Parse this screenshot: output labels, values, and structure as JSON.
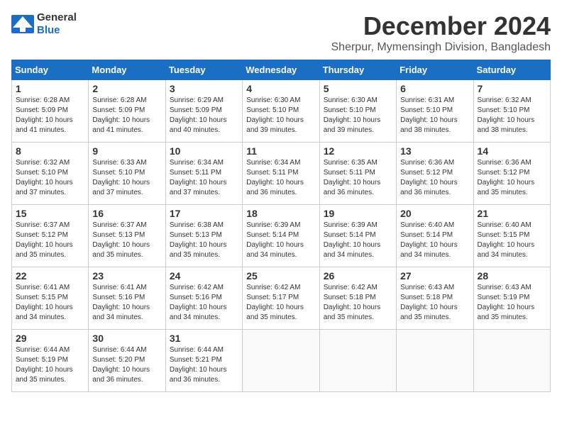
{
  "logo": {
    "general": "General",
    "blue": "Blue"
  },
  "header": {
    "month": "December 2024",
    "location": "Sherpur, Mymensingh Division, Bangladesh"
  },
  "weekdays": [
    "Sunday",
    "Monday",
    "Tuesday",
    "Wednesday",
    "Thursday",
    "Friday",
    "Saturday"
  ],
  "weeks": [
    [
      {
        "day": "1",
        "sunrise": "6:28 AM",
        "sunset": "5:09 PM",
        "daylight": "10 hours and 41 minutes."
      },
      {
        "day": "2",
        "sunrise": "6:28 AM",
        "sunset": "5:09 PM",
        "daylight": "10 hours and 41 minutes."
      },
      {
        "day": "3",
        "sunrise": "6:29 AM",
        "sunset": "5:09 PM",
        "daylight": "10 hours and 40 minutes."
      },
      {
        "day": "4",
        "sunrise": "6:30 AM",
        "sunset": "5:10 PM",
        "daylight": "10 hours and 39 minutes."
      },
      {
        "day": "5",
        "sunrise": "6:30 AM",
        "sunset": "5:10 PM",
        "daylight": "10 hours and 39 minutes."
      },
      {
        "day": "6",
        "sunrise": "6:31 AM",
        "sunset": "5:10 PM",
        "daylight": "10 hours and 38 minutes."
      },
      {
        "day": "7",
        "sunrise": "6:32 AM",
        "sunset": "5:10 PM",
        "daylight": "10 hours and 38 minutes."
      }
    ],
    [
      {
        "day": "8",
        "sunrise": "6:32 AM",
        "sunset": "5:10 PM",
        "daylight": "10 hours and 37 minutes."
      },
      {
        "day": "9",
        "sunrise": "6:33 AM",
        "sunset": "5:10 PM",
        "daylight": "10 hours and 37 minutes."
      },
      {
        "day": "10",
        "sunrise": "6:34 AM",
        "sunset": "5:11 PM",
        "daylight": "10 hours and 37 minutes."
      },
      {
        "day": "11",
        "sunrise": "6:34 AM",
        "sunset": "5:11 PM",
        "daylight": "10 hours and 36 minutes."
      },
      {
        "day": "12",
        "sunrise": "6:35 AM",
        "sunset": "5:11 PM",
        "daylight": "10 hours and 36 minutes."
      },
      {
        "day": "13",
        "sunrise": "6:36 AM",
        "sunset": "5:12 PM",
        "daylight": "10 hours and 36 minutes."
      },
      {
        "day": "14",
        "sunrise": "6:36 AM",
        "sunset": "5:12 PM",
        "daylight": "10 hours and 35 minutes."
      }
    ],
    [
      {
        "day": "15",
        "sunrise": "6:37 AM",
        "sunset": "5:12 PM",
        "daylight": "10 hours and 35 minutes."
      },
      {
        "day": "16",
        "sunrise": "6:37 AM",
        "sunset": "5:13 PM",
        "daylight": "10 hours and 35 minutes."
      },
      {
        "day": "17",
        "sunrise": "6:38 AM",
        "sunset": "5:13 PM",
        "daylight": "10 hours and 35 minutes."
      },
      {
        "day": "18",
        "sunrise": "6:39 AM",
        "sunset": "5:14 PM",
        "daylight": "10 hours and 34 minutes."
      },
      {
        "day": "19",
        "sunrise": "6:39 AM",
        "sunset": "5:14 PM",
        "daylight": "10 hours and 34 minutes."
      },
      {
        "day": "20",
        "sunrise": "6:40 AM",
        "sunset": "5:14 PM",
        "daylight": "10 hours and 34 minutes."
      },
      {
        "day": "21",
        "sunrise": "6:40 AM",
        "sunset": "5:15 PM",
        "daylight": "10 hours and 34 minutes."
      }
    ],
    [
      {
        "day": "22",
        "sunrise": "6:41 AM",
        "sunset": "5:15 PM",
        "daylight": "10 hours and 34 minutes."
      },
      {
        "day": "23",
        "sunrise": "6:41 AM",
        "sunset": "5:16 PM",
        "daylight": "10 hours and 34 minutes."
      },
      {
        "day": "24",
        "sunrise": "6:42 AM",
        "sunset": "5:16 PM",
        "daylight": "10 hours and 34 minutes."
      },
      {
        "day": "25",
        "sunrise": "6:42 AM",
        "sunset": "5:17 PM",
        "daylight": "10 hours and 35 minutes."
      },
      {
        "day": "26",
        "sunrise": "6:42 AM",
        "sunset": "5:18 PM",
        "daylight": "10 hours and 35 minutes."
      },
      {
        "day": "27",
        "sunrise": "6:43 AM",
        "sunset": "5:18 PM",
        "daylight": "10 hours and 35 minutes."
      },
      {
        "day": "28",
        "sunrise": "6:43 AM",
        "sunset": "5:19 PM",
        "daylight": "10 hours and 35 minutes."
      }
    ],
    [
      {
        "day": "29",
        "sunrise": "6:44 AM",
        "sunset": "5:19 PM",
        "daylight": "10 hours and 35 minutes."
      },
      {
        "day": "30",
        "sunrise": "6:44 AM",
        "sunset": "5:20 PM",
        "daylight": "10 hours and 36 minutes."
      },
      {
        "day": "31",
        "sunrise": "6:44 AM",
        "sunset": "5:21 PM",
        "daylight": "10 hours and 36 minutes."
      },
      null,
      null,
      null,
      null
    ]
  ]
}
